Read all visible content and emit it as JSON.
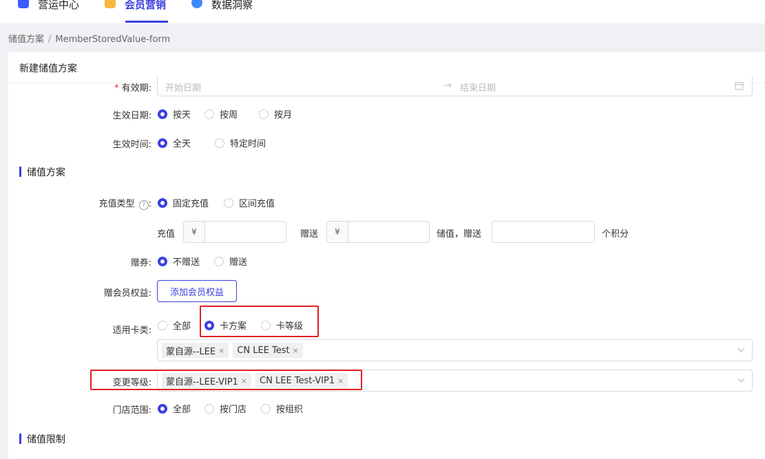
{
  "nav": {
    "tabs": [
      {
        "label": "营运中心",
        "icon": "ops-app-icon",
        "color": "#3b5bff"
      },
      {
        "label": "会员营销",
        "icon": "member-app-icon",
        "color": "#f6b73c"
      },
      {
        "label": "数据洞察",
        "icon": "data-app-icon",
        "color": "#3b8bff"
      }
    ],
    "active_index": 1
  },
  "breadcrumb": {
    "parent": "储值方案",
    "separator": "/",
    "current": "MemberStoredValue-form"
  },
  "page": {
    "title": "新建储值方案"
  },
  "validity": {
    "required_mark": "*",
    "label": "有效期:",
    "start_placeholder": "开始日期",
    "arrow": "→",
    "end_placeholder": "结束日期"
  },
  "effective_date": {
    "label": "生效日期:",
    "options": [
      "按天",
      "按周",
      "按月"
    ],
    "selected": 0
  },
  "effective_time": {
    "label": "生效时间:",
    "options": [
      "全天",
      "特定时间"
    ],
    "selected": 0
  },
  "section_plan": {
    "title": "储值方案"
  },
  "recharge_type": {
    "label": "充值类型",
    "help": "?",
    "colon": ":",
    "options": [
      "固定充值",
      "区间充值"
    ],
    "selected": 0
  },
  "amount_row": {
    "recharge_label": "充值",
    "currency": "¥",
    "gift_label": "赠送",
    "gift_currency": "¥",
    "value_gift_label": "储值，赠送",
    "points_label": "个积分"
  },
  "coupon": {
    "label": "赠券:",
    "options": [
      "不赠送",
      "赠送"
    ],
    "selected": 0
  },
  "benefit": {
    "label": "赠会员权益:",
    "button": "添加会员权益"
  },
  "card_type": {
    "label": "适用卡类:",
    "options": [
      "全部",
      "卡方案",
      "卡等级"
    ],
    "selected": 1,
    "tags": [
      "蒙自源--LEE",
      "CN LEE Test"
    ]
  },
  "change_level": {
    "label": "变更等级:",
    "tags": [
      "蒙自源--LEE-VIP1",
      "CN LEE Test-VIP1"
    ]
  },
  "store_scope": {
    "label": "门店范围:",
    "options": [
      "全部",
      "按门店",
      "按组织"
    ],
    "selected": 0
  },
  "section_limit": {
    "title": "储值限制"
  },
  "icons": {
    "calendar": "calendar-icon",
    "chevron": "chevron-down-icon",
    "remove": "close-icon",
    "remove_glyph": "×"
  },
  "colors": {
    "accent": "#3b3fe0",
    "highlight": "#e02020",
    "required": "#f5222d"
  }
}
